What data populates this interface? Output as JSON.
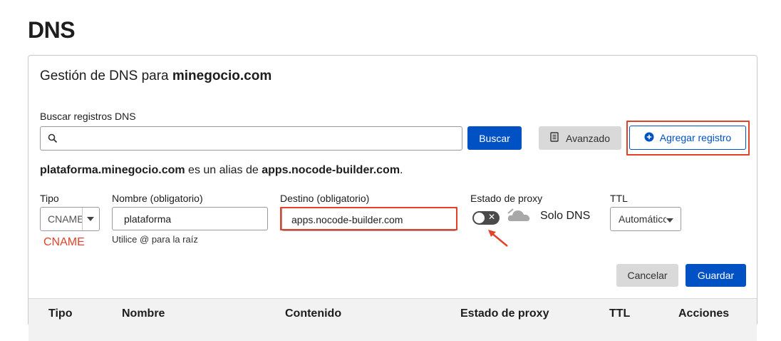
{
  "page_title": "DNS",
  "card": {
    "heading_prefix": "Gestión de DNS para",
    "domain": "minegocio.com"
  },
  "search": {
    "label": "Buscar registros DNS",
    "value": "",
    "placeholder": "",
    "button_label": "Buscar"
  },
  "toolbar": {
    "advanced_label": "Avanzado",
    "add_record_label": "Agregar registro"
  },
  "alias": {
    "host": "plataforma.minegocio.com",
    "connector": "es un alias de",
    "target": "apps.nocode-builder.com",
    "suffix": "."
  },
  "form": {
    "type_label": "Tipo",
    "type_value": "CNAME",
    "type_note": "CNAME",
    "name_label": "Nombre (obligatorio)",
    "name_value": "plataforma",
    "name_help": "Utilice @ para la raíz",
    "target_label": "Destino (obligatorio)",
    "target_value": "apps.nocode-builder.com",
    "proxy_label": "Estado de proxy",
    "proxy_on": false,
    "proxy_status": "Solo DNS",
    "ttl_label": "TTL",
    "ttl_value": "Automático",
    "cancel_label": "Cancelar",
    "save_label": "Guardar"
  },
  "table": {
    "columns": [
      "Tipo",
      "Nombre",
      "Contenido",
      "Estado de proxy",
      "TTL",
      "Acciones"
    ]
  },
  "colors": {
    "primary": "#0051c3",
    "annotation": "#e0432a"
  },
  "icons": {
    "search": "search-icon",
    "advanced": "document-icon",
    "add": "plus-circle-icon",
    "caret": "chevron-down-icon",
    "cloud": "cloud-icon",
    "arrow": "annotation-arrow-icon"
  }
}
